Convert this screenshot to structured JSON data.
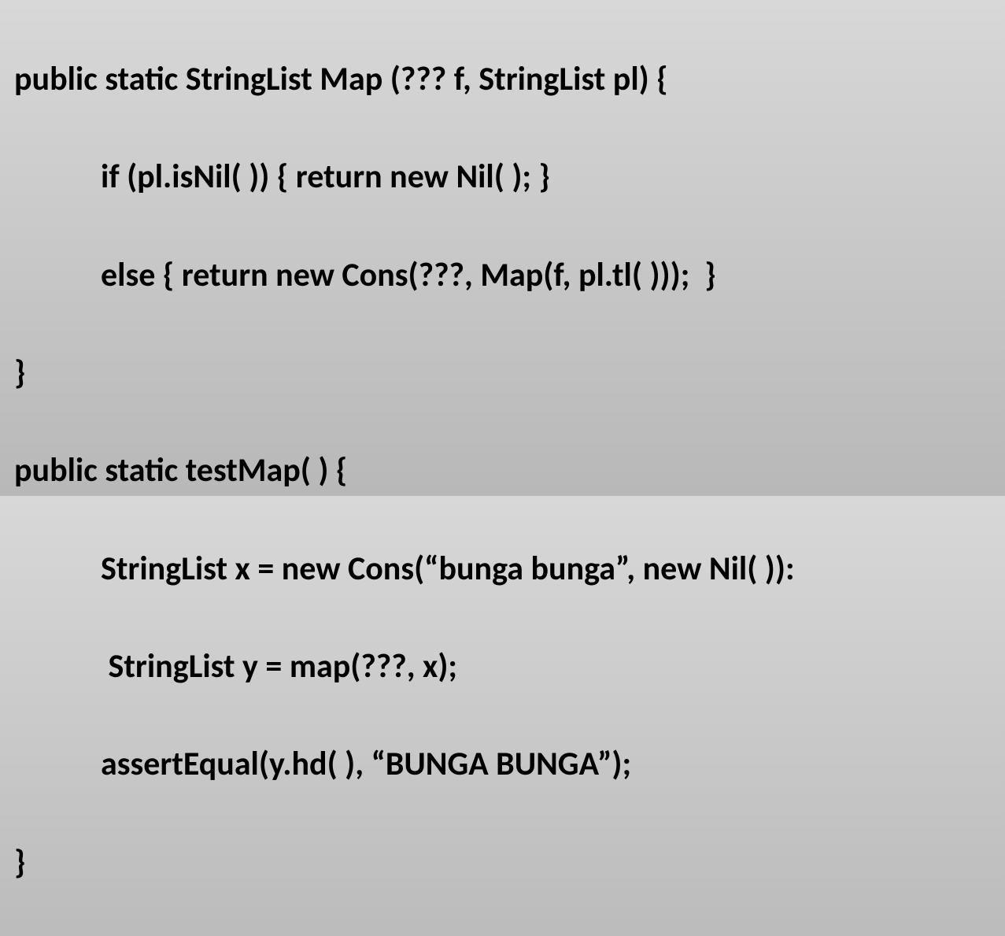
{
  "code": {
    "line1": "public static StringList Map (??? f, StringList pl) {",
    "line2": "if (pl.isNil( )) { return new Nil( ); }",
    "line3": "else { return new Cons(???, Map(f, pl.tl( )));  }",
    "line4": "}",
    "line5": "public static testMap( ) {",
    "line6": "StringList x = new Cons(“bunga bunga”, new Nil( )):",
    "line7": " StringList y = map(???, x);",
    "line8": "assertEqual(y.hd( ), “BUNGA BUNGA”);",
    "line9": "}"
  }
}
